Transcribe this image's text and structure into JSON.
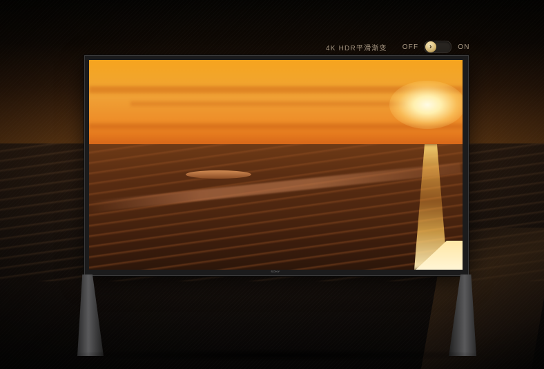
{
  "toggle": {
    "title": "4K HDR平滑渐变",
    "off_label": "OFF",
    "on_label": "ON",
    "state": "off",
    "knob_icon": "chevron-right-icon"
  },
  "tv": {
    "brand": "SONY"
  },
  "colors": {
    "accent": "#e9c77a",
    "label": "#b5a48e"
  }
}
